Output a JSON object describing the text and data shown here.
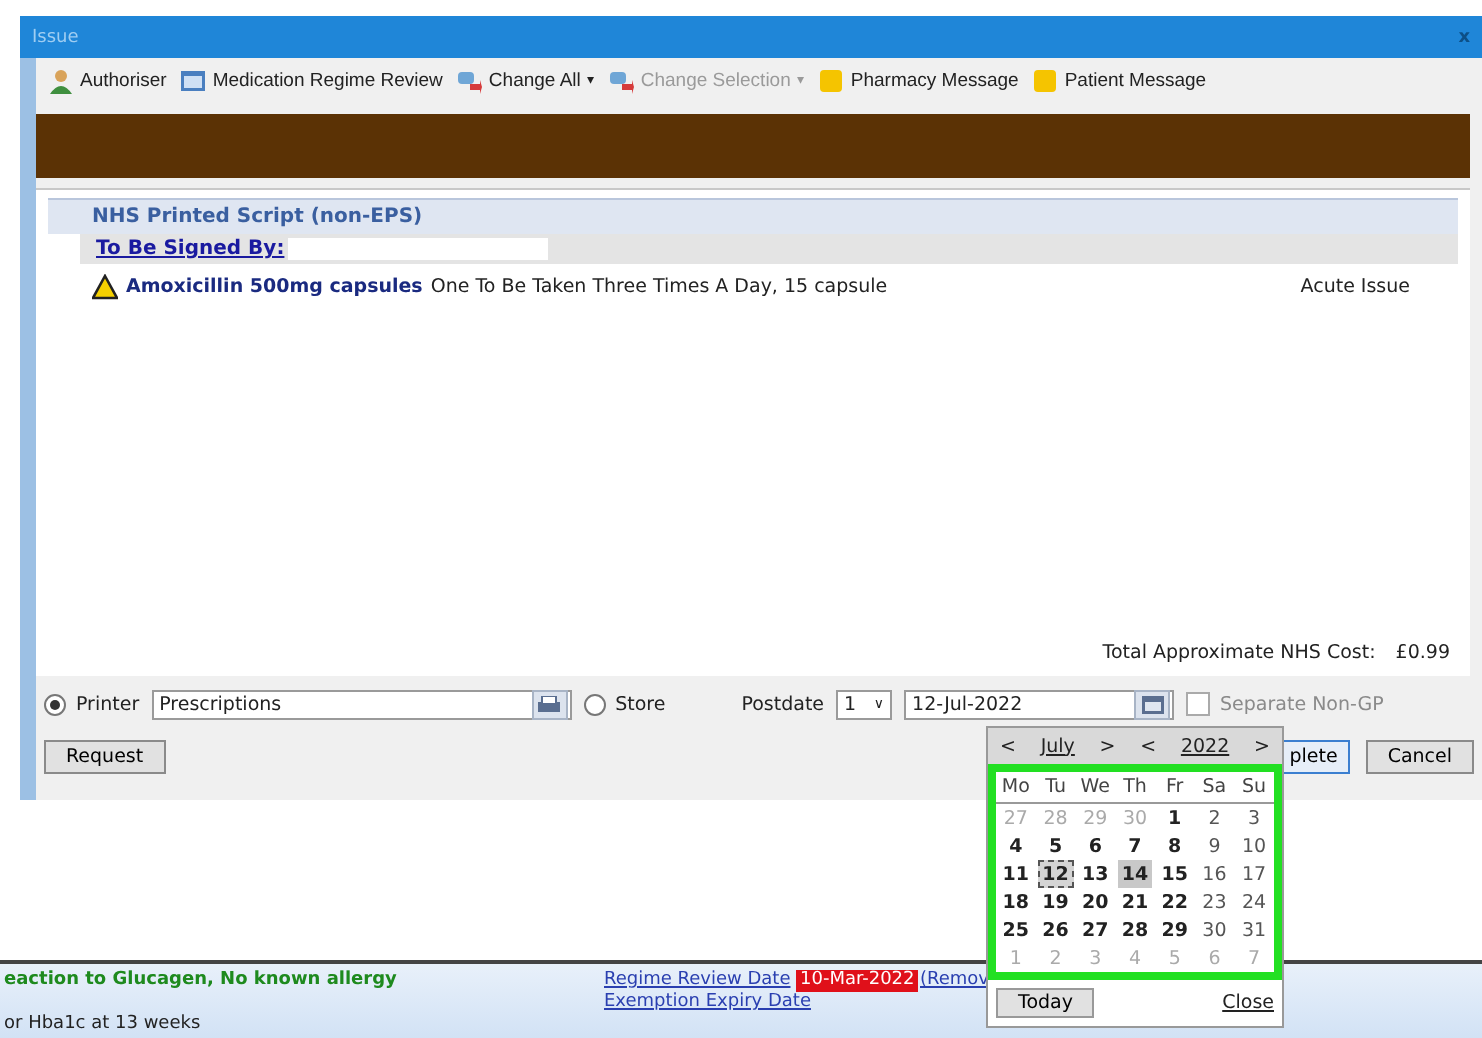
{
  "window": {
    "title": "Issue",
    "close": "x"
  },
  "toolbar": [
    {
      "kind": "person",
      "label": "Authoriser",
      "disabled": false,
      "dropdown": false
    },
    {
      "kind": "regime",
      "label": "Medication Regime Review",
      "disabled": false,
      "dropdown": false
    },
    {
      "kind": "change",
      "label": "Change All",
      "disabled": false,
      "dropdown": "▾"
    },
    {
      "kind": "change",
      "label": "Change Selection",
      "disabled": true,
      "dropdown": "▾"
    },
    {
      "kind": "note",
      "label": "Pharmacy Message",
      "disabled": false,
      "dropdown": false
    },
    {
      "kind": "note",
      "label": "Patient Message",
      "disabled": false,
      "dropdown": false
    }
  ],
  "script": {
    "heading": "NHS Printed Script (non-EPS)",
    "signed_by_label": "To Be Signed By:",
    "items": [
      {
        "drug": "Amoxicillin 500mg capsules",
        "dosage": "One To Be Taken Three Times A Day, 15 capsule",
        "type": "Acute Issue"
      }
    ],
    "total_label": "Total Approximate NHS Cost:",
    "total_value": "£0.99"
  },
  "output": {
    "printer_label": "Printer",
    "printer_selected": true,
    "printer_value": "Prescriptions",
    "store_label": "Store",
    "store_selected": false,
    "postdate_label": "Postdate",
    "postdate_value": "1",
    "postdate_caret": "∨",
    "date_value": "12-Jul-2022",
    "separate_label": "Separate Non-GP",
    "separate_checked": false
  },
  "buttons": {
    "request": "Request",
    "complete": "plete",
    "cancel": "Cancel"
  },
  "calendar": {
    "prev": "<",
    "month": "July",
    "next": ">",
    "year_prev": "<",
    "year": "2022",
    "year_next": ">",
    "weekdays": [
      "Mo",
      "Tu",
      "We",
      "Th",
      "Fr",
      "Sa",
      "Su"
    ],
    "weeks": [
      [
        {
          "day": "27",
          "kind": "other",
          "selected": false,
          "hovered": false
        },
        {
          "day": "28",
          "kind": "other",
          "selected": false,
          "hovered": false
        },
        {
          "day": "29",
          "kind": "other",
          "selected": false,
          "hovered": false
        },
        {
          "day": "30",
          "kind": "other",
          "selected": false,
          "hovered": false
        },
        {
          "day": "1",
          "kind": "weekday",
          "selected": false,
          "hovered": false
        },
        {
          "day": "2",
          "kind": "weekend",
          "selected": false,
          "hovered": false
        },
        {
          "day": "3",
          "kind": "weekend",
          "selected": false,
          "hovered": false
        }
      ],
      [
        {
          "day": "4",
          "kind": "weekday",
          "selected": false,
          "hovered": false
        },
        {
          "day": "5",
          "kind": "weekday",
          "selected": false,
          "hovered": false
        },
        {
          "day": "6",
          "kind": "weekday",
          "selected": false,
          "hovered": false
        },
        {
          "day": "7",
          "kind": "weekday",
          "selected": false,
          "hovered": false
        },
        {
          "day": "8",
          "kind": "weekday",
          "selected": false,
          "hovered": false
        },
        {
          "day": "9",
          "kind": "weekend",
          "selected": false,
          "hovered": false
        },
        {
          "day": "10",
          "kind": "weekend",
          "selected": false,
          "hovered": false
        }
      ],
      [
        {
          "day": "11",
          "kind": "weekday",
          "selected": false,
          "hovered": false
        },
        {
          "day": "12",
          "kind": "weekday",
          "selected": true,
          "hovered": false
        },
        {
          "day": "13",
          "kind": "weekday",
          "selected": false,
          "hovered": false
        },
        {
          "day": "14",
          "kind": "weekday",
          "selected": false,
          "hovered": true
        },
        {
          "day": "15",
          "kind": "weekday",
          "selected": false,
          "hovered": false
        },
        {
          "day": "16",
          "kind": "weekend",
          "selected": false,
          "hovered": false
        },
        {
          "day": "17",
          "kind": "weekend",
          "selected": false,
          "hovered": false
        }
      ],
      [
        {
          "day": "18",
          "kind": "weekday",
          "selected": false,
          "hovered": false
        },
        {
          "day": "19",
          "kind": "weekday",
          "selected": false,
          "hovered": false
        },
        {
          "day": "20",
          "kind": "weekday",
          "selected": false,
          "hovered": false
        },
        {
          "day": "21",
          "kind": "weekday",
          "selected": false,
          "hovered": false
        },
        {
          "day": "22",
          "kind": "weekday",
          "selected": false,
          "hovered": false
        },
        {
          "day": "23",
          "kind": "weekend",
          "selected": false,
          "hovered": false
        },
        {
          "day": "24",
          "kind": "weekend",
          "selected": false,
          "hovered": false
        }
      ],
      [
        {
          "day": "25",
          "kind": "weekday",
          "selected": false,
          "hovered": false
        },
        {
          "day": "26",
          "kind": "weekday",
          "selected": false,
          "hovered": false
        },
        {
          "day": "27",
          "kind": "weekday",
          "selected": false,
          "hovered": false
        },
        {
          "day": "28",
          "kind": "weekday",
          "selected": false,
          "hovered": false
        },
        {
          "day": "29",
          "kind": "weekday",
          "selected": false,
          "hovered": false
        },
        {
          "day": "30",
          "kind": "weekend",
          "selected": false,
          "hovered": false
        },
        {
          "day": "31",
          "kind": "weekend",
          "selected": false,
          "hovered": false
        }
      ],
      [
        {
          "day": "1",
          "kind": "other",
          "selected": false,
          "hovered": false
        },
        {
          "day": "2",
          "kind": "other",
          "selected": false,
          "hovered": false
        },
        {
          "day": "3",
          "kind": "other",
          "selected": false,
          "hovered": false
        },
        {
          "day": "4",
          "kind": "other",
          "selected": false,
          "hovered": false
        },
        {
          "day": "5",
          "kind": "other",
          "selected": false,
          "hovered": false
        },
        {
          "day": "6",
          "kind": "other",
          "selected": false,
          "hovered": false
        },
        {
          "day": "7",
          "kind": "other",
          "selected": false,
          "hovered": false
        }
      ]
    ],
    "today": "Today",
    "close": "Close"
  },
  "patient_bar": {
    "allergy": "eaction to Glucagen, No known allergy",
    "regime_review_label": "Regime Review Date",
    "regime_review_date": "10-Mar-2022",
    "remove": "(Remov",
    "exemption_label": "Exemption Expiry Date",
    "note": "or Hba1c at 13 weeks"
  }
}
